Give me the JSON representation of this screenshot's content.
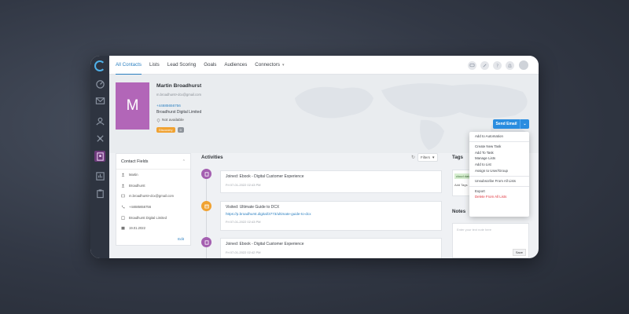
{
  "nav": {
    "tabs": [
      {
        "label": "All Contacts"
      },
      {
        "label": "Lists"
      },
      {
        "label": "Lead Scoring"
      },
      {
        "label": "Goals"
      },
      {
        "label": "Audiences"
      },
      {
        "label": "Connectors"
      }
    ]
  },
  "contact": {
    "initial": "M",
    "name": "Martin Broadhurst",
    "email": "m.broadhurst+dcx@gmail.com",
    "phone": "+44685656756",
    "company": "Broadhurst Digital Limited",
    "location": "Not available",
    "badge_status": "Discovery",
    "badge_count": "0"
  },
  "send_email": {
    "label": "Send Email"
  },
  "dropdown": {
    "items": [
      "Add to Automation",
      "Create New Task",
      "Add To Task",
      "Manage Lists",
      "Add to List",
      "Assign to User/Group",
      "Unsubscribe From All Lists",
      "Export",
      "Delete From All Lists"
    ]
  },
  "contact_fields": {
    "title": "Contact Fields",
    "rows": [
      "Martin",
      "Broadhurst",
      "m.broadhurst+dcx@gmail.com",
      "+44685656756",
      "Broadhurst Digital Limited",
      "19.01.2022"
    ],
    "edit_label": "Edit"
  },
  "activities": {
    "title": "Activities",
    "filter_label": "Filters",
    "items": [
      {
        "title": "Joined: Ebook - Digital Customer Experience",
        "link": "",
        "time": "Fri 07-01-2022 02:43 PM"
      },
      {
        "title": "Visited: Ultimate Guide to DCX",
        "link": "https://p.broadhurst.digital/3773/ultimate-guide-to-dcx",
        "time": "Fri 07-01-2022 02:43 PM"
      },
      {
        "title": "Joined: Ebook - Digital Customer Experience",
        "link": "",
        "time": "Fri 07-01-2022 02:42 PM"
      }
    ]
  },
  "tags": {
    "title": "Tags",
    "chip": "cloud data",
    "add_label": "Add Tags"
  },
  "notes": {
    "title": "Notes",
    "placeholder": "Enter your text note here",
    "save_label": "Save"
  },
  "colors": {
    "accent": "#2a7fc0",
    "avatar": "#b266b8",
    "send_button": "#2a8de0",
    "danger": "#e0303a",
    "rail": "#2e3440"
  }
}
